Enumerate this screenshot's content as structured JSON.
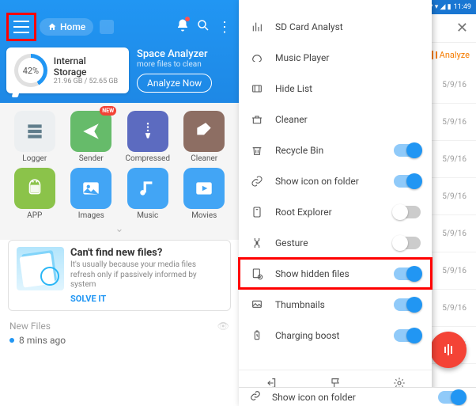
{
  "left": {
    "home_label": "Home",
    "storage": {
      "percent": "42%",
      "title": "Internal Storage",
      "subtitle": "21.96 GB / 52.65 GB"
    },
    "analyzer": {
      "title": "Space Analyzer",
      "subtitle": "more files to clean",
      "button": "Analyze Now"
    },
    "grid": [
      {
        "label": "Logger"
      },
      {
        "label": "Sender",
        "badge": "NEW"
      },
      {
        "label": "Compressed"
      },
      {
        "label": "Cleaner"
      },
      {
        "label": "APP"
      },
      {
        "label": "Images"
      },
      {
        "label": "Music"
      },
      {
        "label": "Movies"
      }
    ],
    "promo": {
      "title": "Can't find new files?",
      "body": "It's usually because your media files refresh only if passively informed by system",
      "cta": "SOLVE IT"
    },
    "newfiles_header": "New Files",
    "newfiles_item": "8 mins ago"
  },
  "right": {
    "status_time": "11:49",
    "close_icon": "close",
    "analyze_chip": "Analyze",
    "date": "5/9/16",
    "drawer_items": [
      {
        "label": "SD Card Analyst",
        "toggle": null
      },
      {
        "label": "Music Player",
        "toggle": null
      },
      {
        "label": "Hide List",
        "toggle": null
      },
      {
        "label": "Cleaner",
        "toggle": null
      },
      {
        "label": "Recycle Bin",
        "toggle": true
      },
      {
        "label": "Show icon on folder",
        "toggle": true
      },
      {
        "label": "Root Explorer",
        "toggle": false
      },
      {
        "label": "Gesture",
        "toggle": false
      },
      {
        "label": "Show hidden files",
        "toggle": true,
        "highlight": true
      },
      {
        "label": "Thumbnails",
        "toggle": true
      },
      {
        "label": "Charging boost",
        "toggle": true
      }
    ],
    "bottom": {
      "exit": "Exit",
      "theme": "Theme",
      "settings": "Settings"
    },
    "extra_row": {
      "label": "Show icon on folder",
      "toggle": true
    }
  }
}
